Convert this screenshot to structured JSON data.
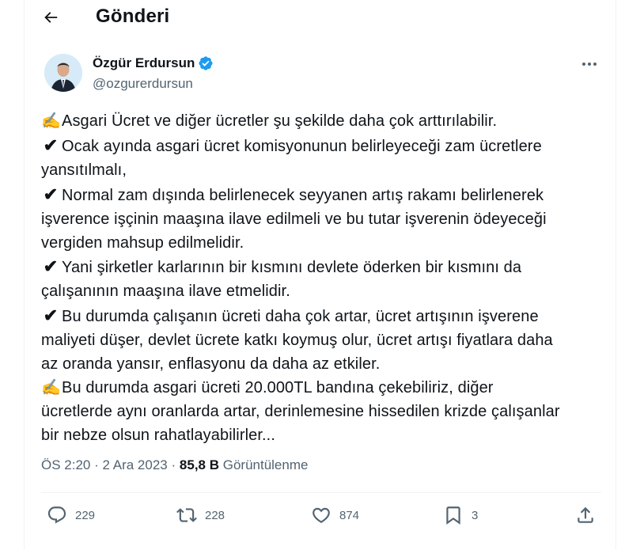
{
  "header": {
    "title": "Gönderi"
  },
  "author": {
    "name": "Özgür Erdursun",
    "handle": "@ozgurerdursun"
  },
  "tweet": {
    "lines": [
      {
        "prefix": "✍️",
        "text": "Asgari Ücret ve diğer ücretler şu şekilde daha çok arttırılabilir."
      },
      {
        "prefix": "✔",
        "text": "Ocak ayında asgari ücret komisyonunun belirleyeceği zam ücretlere"
      },
      {
        "prefix": "",
        "text": "yansıtılmalı,"
      },
      {
        "prefix": "✔",
        "text": "Normal zam dışında belirlenecek seyyanen artış rakamı belirlenerek"
      },
      {
        "prefix": "",
        "text": "işverence işçinin maaşına ilave edilmeli ve bu tutar işverenin ödeyeceği"
      },
      {
        "prefix": "",
        "text": "vergiden mahsup edilmelidir."
      },
      {
        "prefix": "✔",
        "text": "Yani şirketler karlarının bir kısmını devlete öderken bir kısmını da"
      },
      {
        "prefix": "",
        "text": "çalışanının maaşına ilave etmelidir."
      },
      {
        "prefix": "✔",
        "text": "Bu durumda çalışanın ücreti daha çok artar, ücret artışının işverene"
      },
      {
        "prefix": "",
        "text": "maliyeti düşer, devlet ücrete katkı koymuş olur, ücret artışı fiyatlara daha"
      },
      {
        "prefix": "",
        "text": "az oranda yansır, enflasyonu da daha az etkiler."
      },
      {
        "prefix": "✍️",
        "text": "Bu durumda asgari ücreti 20.000TL bandına çekebiliriz, diğer"
      },
      {
        "prefix": "",
        "text": "ücretlerde aynı oranlarda artar, derinlemesine hissedilen krizde çalışanlar"
      },
      {
        "prefix": "",
        "text": "bir nebze olsun rahatlayabilirler..."
      }
    ]
  },
  "meta": {
    "time": "ÖS 2:20",
    "sep1": "·",
    "date": "2 Ara 2023",
    "sep2": "·",
    "views": "85,8 B",
    "views_label": "Görüntülenme"
  },
  "actions": {
    "replies": "229",
    "reposts": "228",
    "likes": "874",
    "bookmarks": "3"
  },
  "colors": {
    "verified": "#1d9bf0",
    "muted": "#536471",
    "text": "#0f1419"
  }
}
